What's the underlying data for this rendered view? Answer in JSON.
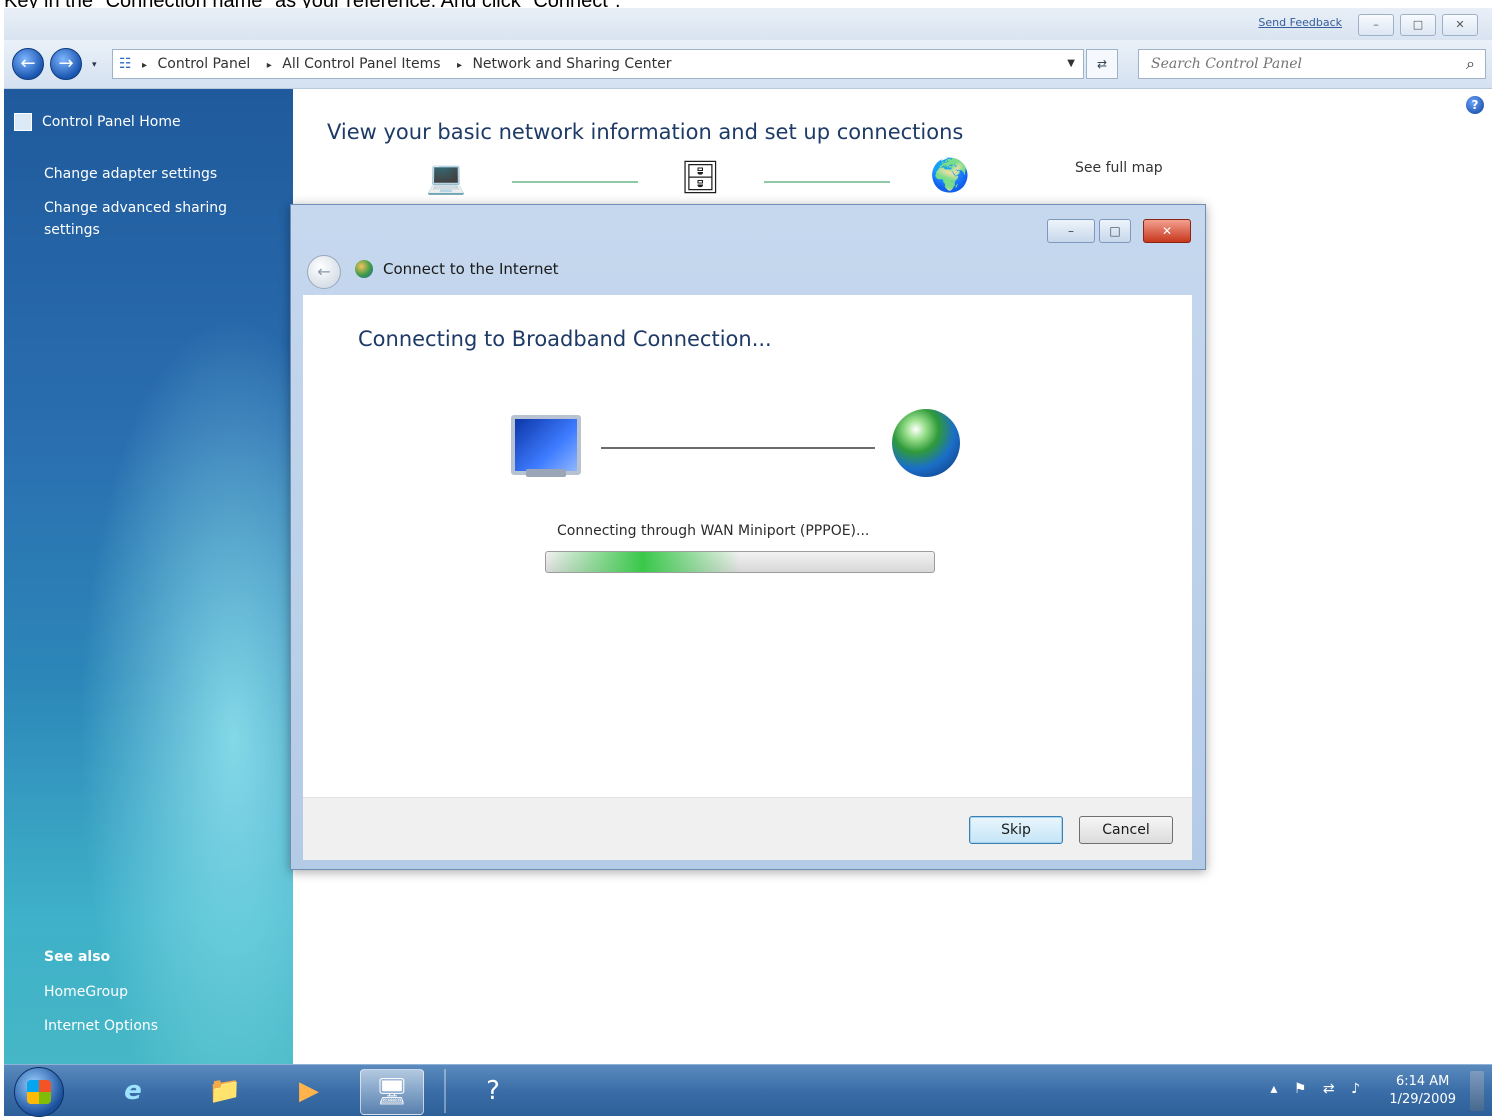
{
  "caption": "Key in the \"Connection name\" as your reference. And click \"Connect\".",
  "window": {
    "send_feedback": "Send Feedback",
    "buttons": {
      "minimize": "–",
      "restore": "□",
      "close": "✕"
    }
  },
  "address_bar": {
    "back_glyph": "←",
    "forward_glyph": "→",
    "recent_glyph": "▾",
    "root_icon": "network-icon",
    "segments": [
      "Control Panel",
      "All Control Panel Items",
      "Network and Sharing Center"
    ],
    "separator": "▸",
    "dropdown_glyph": "▼",
    "refresh_glyph": "⇄"
  },
  "search": {
    "placeholder": "Search Control Panel",
    "icon_glyph": "⌕"
  },
  "sidebar": {
    "home": "Control Panel Home",
    "links": [
      "Change adapter settings",
      "Change advanced sharing settings"
    ],
    "see_also_label": "See also",
    "see_also_links": [
      "HomeGroup",
      "Internet Options"
    ]
  },
  "main": {
    "heading": "View your basic network information and set up connections",
    "see_full_map": "See full map",
    "help_glyph": "?",
    "map_icons": {
      "computer": "💻",
      "router": "🗄",
      "globe": "🌍"
    }
  },
  "dialog": {
    "title": "Connect to the Internet",
    "back_glyph": "←",
    "controls": {
      "minimize": "–",
      "maximize": "□",
      "close": "✕"
    },
    "heading": "Connecting to Broadband Connection...",
    "status": "Connecting through WAN Miniport (PPPOE)...",
    "progress_fraction": 0.5,
    "buttons": {
      "skip": "Skip",
      "cancel": "Cancel"
    }
  },
  "taskbar": {
    "pinned": [
      {
        "name": "ie-icon",
        "glyph": "e"
      },
      {
        "name": "explorer-icon",
        "glyph": "📁"
      },
      {
        "name": "media-player-icon",
        "glyph": "▶"
      },
      {
        "name": "network-window-icon",
        "glyph": "🖥"
      },
      {
        "name": "help-icon",
        "glyph": "?"
      }
    ],
    "tray": {
      "arrow": "▴",
      "flag": "⚑",
      "network": "⇄",
      "volume": "♪"
    },
    "clock_time": "6:14 AM",
    "clock_date": "1/29/2009"
  },
  "colors": {
    "sidebar_top": "#1f5a9c",
    "sidebar_bottom": "#46b7c6",
    "heading": "#1e3a66",
    "progress": "#39c84a"
  }
}
